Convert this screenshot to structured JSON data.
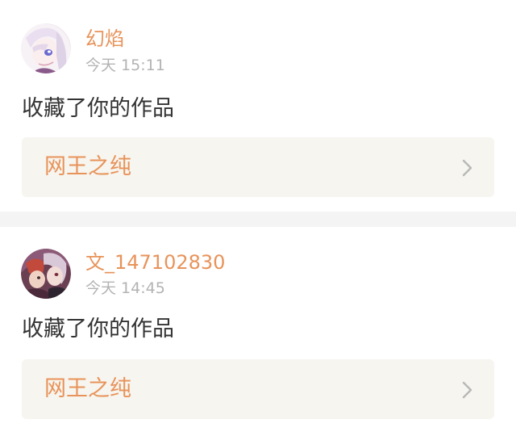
{
  "notifications": [
    {
      "username": "幻焰",
      "time": "今天 15:11",
      "action": "收藏了你的作品",
      "work_title": "网王之纯",
      "avatar_icon": "anime-girl-avatar-icon",
      "chevron_icon": "chevron-right-icon"
    },
    {
      "username": "文_147102830",
      "time": "今天 14:45",
      "action": "收藏了你的作品",
      "work_title": "网王之纯",
      "avatar_icon": "anime-couple-avatar-icon",
      "chevron_icon": "chevron-right-icon"
    }
  ],
  "colors": {
    "accent": "#e8935a",
    "text": "#333333",
    "meta": "#b3b3b3",
    "card_bg": "#ffffff",
    "link_bg": "#f6f5ef",
    "page_bg": "#f4f4f4"
  }
}
